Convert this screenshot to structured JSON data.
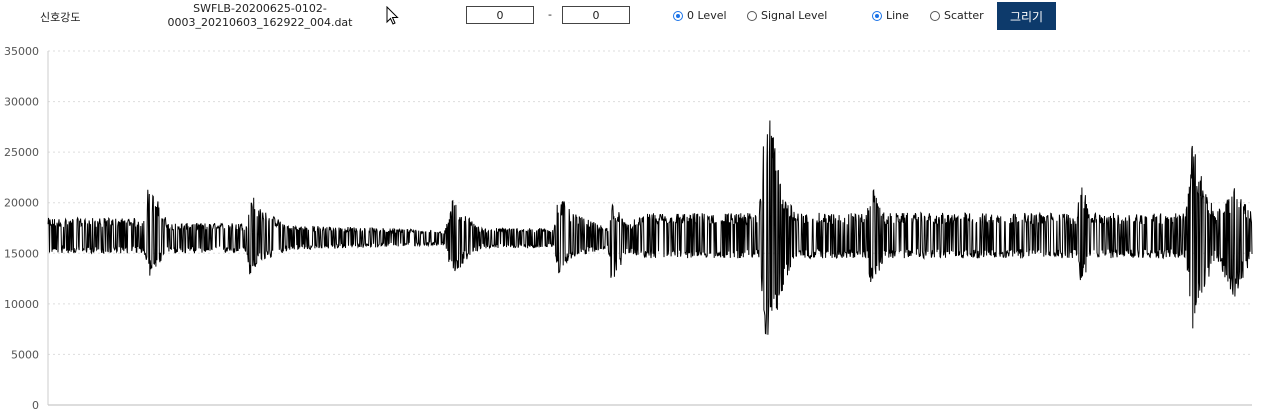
{
  "toolbar": {
    "title_label": "신호강도",
    "filename_line1": "SWFLB-20200625-0102-",
    "filename_line2": "0003_20210603_162922_004.dat",
    "range_start": "0",
    "range_sep": "-",
    "range_end": "0",
    "level_options": [
      {
        "label": "0 Level",
        "checked": true
      },
      {
        "label": "Signal Level",
        "checked": false
      }
    ],
    "mode_options": [
      {
        "label": "Line",
        "checked": true
      },
      {
        "label": "Scatter",
        "checked": false
      }
    ],
    "draw_button_label": "그리기"
  },
  "colors": {
    "button_bg": "#0d3a6b",
    "radio_accent": "#1a73e8",
    "signal_line": "#000000",
    "grid": "#dddddd"
  },
  "chart_data": {
    "type": "line",
    "ylim": [
      0,
      35000
    ],
    "yticks": [
      0,
      5000,
      10000,
      15000,
      20000,
      25000,
      30000,
      35000
    ],
    "grid": "horizontal dotted",
    "baseline": 16500,
    "series": [
      {
        "envelope_points": [
          {
            "x": 0.0,
            "max": 18500,
            "min": 15000
          },
          {
            "x": 0.08,
            "max": 18500,
            "min": 15000
          },
          {
            "x": 0.083,
            "max": 21500,
            "min": 12500
          },
          {
            "x": 0.09,
            "max": 20500,
            "min": 13500
          },
          {
            "x": 0.1,
            "max": 18000,
            "min": 15000
          },
          {
            "x": 0.165,
            "max": 18000,
            "min": 15000
          },
          {
            "x": 0.168,
            "max": 21500,
            "min": 12300
          },
          {
            "x": 0.175,
            "max": 19500,
            "min": 14000
          },
          {
            "x": 0.2,
            "max": 17800,
            "min": 15300
          },
          {
            "x": 0.33,
            "max": 17300,
            "min": 15800
          },
          {
            "x": 0.336,
            "max": 20300,
            "min": 12400
          },
          {
            "x": 0.345,
            "max": 19000,
            "min": 14000
          },
          {
            "x": 0.36,
            "max": 17500,
            "min": 15500
          },
          {
            "x": 0.42,
            "max": 17500,
            "min": 15500
          },
          {
            "x": 0.424,
            "max": 21000,
            "min": 12800
          },
          {
            "x": 0.435,
            "max": 19000,
            "min": 14500
          },
          {
            "x": 0.465,
            "max": 17500,
            "min": 15500
          },
          {
            "x": 0.468,
            "max": 20300,
            "min": 11600
          },
          {
            "x": 0.48,
            "max": 18000,
            "min": 15000
          },
          {
            "x": 0.5,
            "max": 19000,
            "min": 14500
          },
          {
            "x": 0.59,
            "max": 19000,
            "min": 14500
          },
          {
            "x": 0.596,
            "max": 30400,
            "min": 5600
          },
          {
            "x": 0.61,
            "max": 22000,
            "min": 11000
          },
          {
            "x": 0.62,
            "max": 19000,
            "min": 14500
          },
          {
            "x": 0.68,
            "max": 19000,
            "min": 14500
          },
          {
            "x": 0.684,
            "max": 21700,
            "min": 11300
          },
          {
            "x": 0.695,
            "max": 19000,
            "min": 14500
          },
          {
            "x": 0.855,
            "max": 19000,
            "min": 14500
          },
          {
            "x": 0.858,
            "max": 22700,
            "min": 11000
          },
          {
            "x": 0.865,
            "max": 19000,
            "min": 14500
          },
          {
            "x": 0.945,
            "max": 19000,
            "min": 14500
          },
          {
            "x": 0.95,
            "max": 26000,
            "min": 7000
          },
          {
            "x": 0.96,
            "max": 22000,
            "min": 11000
          },
          {
            "x": 0.97,
            "max": 19000,
            "min": 14500
          },
          {
            "x": 0.985,
            "max": 21500,
            "min": 10500
          },
          {
            "x": 1.0,
            "max": 19000,
            "min": 14500
          }
        ]
      }
    ]
  }
}
